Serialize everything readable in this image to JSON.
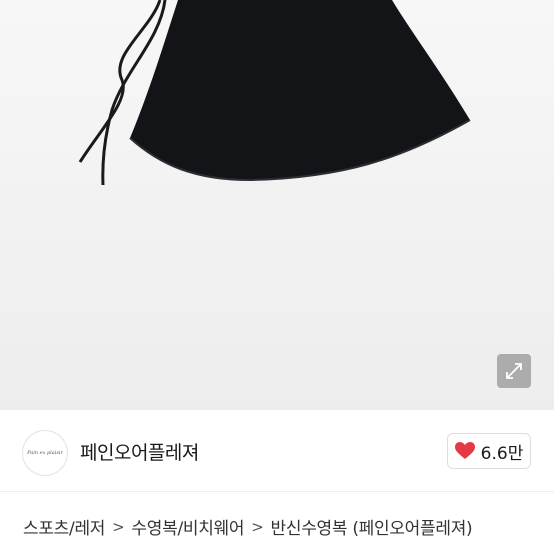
{
  "product_image": {
    "expand_icon": "expand-arrows-icon"
  },
  "shop": {
    "avatar_text": "Pain ex plaisir",
    "name": "페인오어플레져",
    "like_icon": "heart-icon",
    "like_color": "#e63946",
    "like_count": "6.6만"
  },
  "breadcrumb": {
    "items": [
      "스포츠/레저",
      "수영복/비치웨어",
      "반신수영복 (페인오어플레져)"
    ],
    "separator": ">"
  }
}
